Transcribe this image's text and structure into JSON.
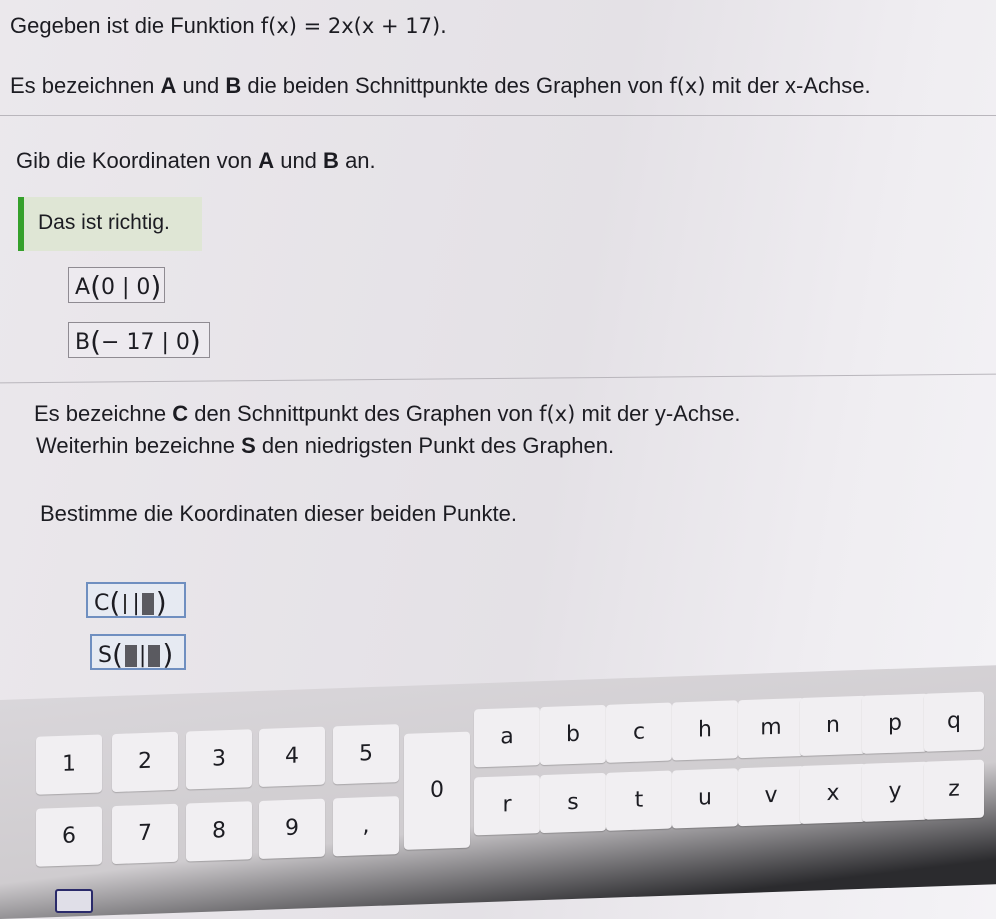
{
  "task1": {
    "intro": "Gegeben ist die Funktion",
    "function": "f(x) = 2x(x + 17).",
    "text_part1": "Es bezeichnen",
    "A": "A",
    "und": "und",
    "B": "B",
    "text_part2": "die beiden Schnittpunkte des Graphen von",
    "fx": "f(x)",
    "text_part3": "mit der x-Achse.",
    "question": "Gib die Koordinaten von",
    "question_A": "A",
    "question_und": "und",
    "question_B": "B",
    "question_end": "an.",
    "feedback": "Das ist richtig.",
    "answer_A_label": "A",
    "answer_A_value": "0 | 0",
    "answer_B_label": "B",
    "answer_B_value": "− 17 | 0"
  },
  "task2": {
    "line1_start": "Es bezeichne",
    "C": "C",
    "line1_mid": "den Schnittpunkt des Graphen von",
    "fx": "f(x)",
    "line1_end": "mit der y-Achse.",
    "line2_start": "Weiterhin bezeichne",
    "S": "S",
    "line2_end": "den niedrigsten Punkt des Graphen.",
    "instruction": "Bestimme die Koordinaten dieser beiden Punkte.",
    "answer_C_label": "C",
    "answer_C_sep": "|",
    "answer_S_label": "S",
    "answer_S_sep": "|"
  },
  "keyboard": {
    "number_keys": [
      "1",
      "2",
      "3",
      "4",
      "5",
      "6",
      "7",
      "8",
      "9",
      ",",
      "0"
    ],
    "letter_keys_row1": [
      "a",
      "b",
      "c",
      "h",
      "m",
      "n",
      "p",
      "q"
    ],
    "letter_keys_row2": [
      "r",
      "s",
      "t",
      "u",
      "v",
      "x",
      "y",
      "z"
    ],
    "icon": "keyboard-icon"
  }
}
